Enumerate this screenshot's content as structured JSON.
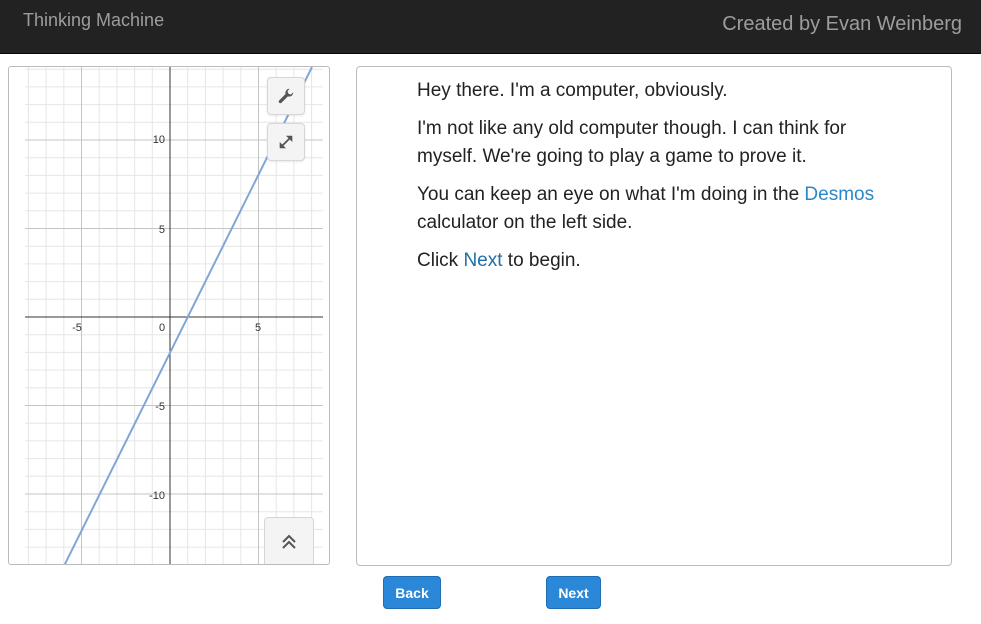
{
  "navbar": {
    "title": "Thinking Machine",
    "credit": "Created by Evan Weinberg"
  },
  "calculator": {
    "x_ticks": [
      "-5",
      "0",
      "5"
    ],
    "y_ticks": [
      "10",
      "5",
      "-5",
      "-10"
    ],
    "line_color": "#7fa7d6",
    "icons": {
      "settings": "wrench-icon",
      "fullscreen": "expand-icon",
      "zoom": "double-chevron-up-icon"
    }
  },
  "message": {
    "p1": "Hey there. I'm a computer, obviously.",
    "p2": "I'm not like any old computer though. I can think for myself. We're going to play a game to prove it.",
    "p3_before": "You can keep an eye on what I'm doing in the ",
    "p3_link": "Desmos",
    "p3_after": " calculator on the left side.",
    "p4_before": "Click ",
    "p4_link": "Next",
    "p4_after": " to begin."
  },
  "buttons": {
    "back": "Back",
    "next": "Next"
  },
  "colors": {
    "navbar": "#222222",
    "button": "#2b88d8",
    "link": "#2b87c8"
  }
}
